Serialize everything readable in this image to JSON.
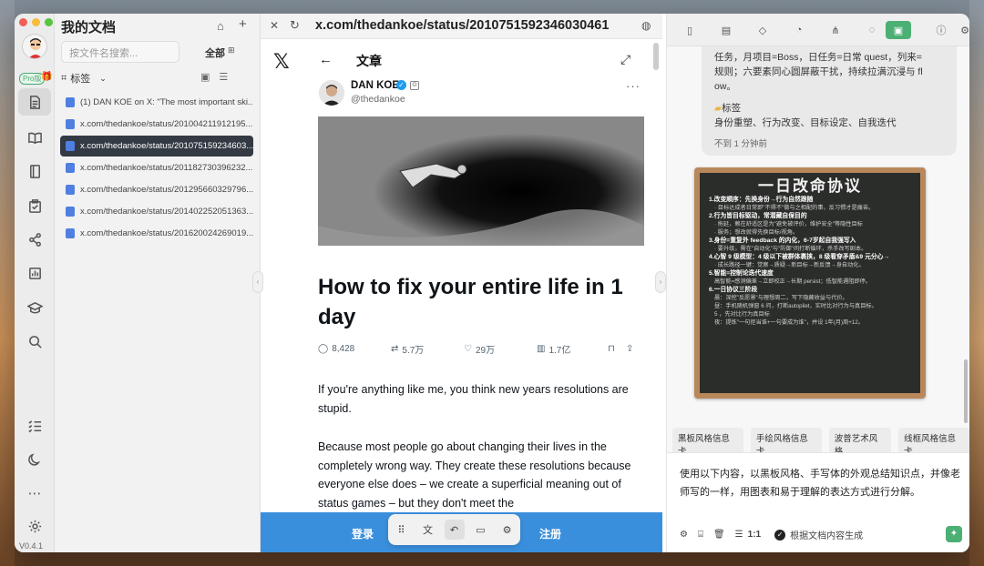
{
  "sidebar": {
    "pro_label": "Pro版",
    "version": "V0.4.1"
  },
  "docs": {
    "title": "我的文档",
    "search_placeholder": "按文件名搜索...",
    "filter_label": "全部",
    "tag_label": "标签",
    "items": [
      {
        "label": "(1) DAN KOE on X: \"The most important ski..."
      },
      {
        "label": "x.com/thedankoe/status/201004211912195..."
      },
      {
        "label": "x.com/thedankoe/status/201075159234603..."
      },
      {
        "label": "x.com/thedankoe/status/201182730396232..."
      },
      {
        "label": "x.com/thedankoe/status/201295660329796..."
      },
      {
        "label": "x.com/thedankoe/status/201402252051363..."
      },
      {
        "label": "x.com/thedankoe/status/201620024269019..."
      }
    ]
  },
  "browser": {
    "url": "x.com/thedankoe/status/2010751592346030461",
    "header_label": "文章",
    "author_name": "DAN KOE",
    "author_handle": "@thedankoe",
    "headline": "How to fix your entire life in 1 day",
    "stats": {
      "replies": "8,428",
      "reposts": "5.7万",
      "likes": "29万",
      "views": "1.7亿"
    },
    "para1": "If you're anything like me, you think new years resolutions are stupid.",
    "para2": "Because most people go about changing their lives in the completely wrong way. They create these resolutions because everyone else does – we create a superficial meaning out of status games – but they don't meet the",
    "login": "登录",
    "signup": "注册"
  },
  "ai": {
    "bubble_line1": "任务，月项目=Boss，日任务=日常 quest，列来=",
    "bubble_line2": "规则；六要素同心圆屏蔽干扰，持续拉满沉浸与 fl",
    "bubble_line3": "ow。",
    "tag_title": "标签",
    "tags": "身份重塑、行为改变、目标设定、自我迭代",
    "time": "不到 1 分钟前",
    "board": {
      "title": "一日改命协议",
      "lines": [
        {
          "t": "1.改变顺序：先换身份→行为自然跟随",
          "h": true
        },
        {
          "t": "· 目标达成者日常即\"不得不\"做与之相配的事，反习惯才是痛苦。",
          "h": false
        },
        {
          "t": "2.行为皆目标驱动，常潜藏自保目的",
          "h": true
        },
        {
          "t": "· 拖延，赖在舒适区是为\"避免被评价，维护安全\"等隐性目标",
          "h": false
        },
        {
          "t": "· 服务；想改就得先换目标/视角。",
          "h": false
        },
        {
          "t": "3.身份=重复外 feedback 的内化，6-7岁起自我强写入",
          "h": true
        },
        {
          "t": "· 要升级，需在\"自动化\"与\"防御\"间打断循环，杀手改写剧本。",
          "h": false
        },
        {
          "t": "4.心智 9 级模型：4 级以下被群体裹挟，8 级看穿矛盾&9 元分心→",
          "h": true
        },
        {
          "t": "· 成长路径一键：觉察→质疑→新目标→新反馈→身自动化。",
          "h": false
        },
        {
          "t": "5.智能=控制论迭代速度",
          "h": true
        },
        {
          "t": "高智能=感测偏差→立即校正→长期 persist；低智能遇阻即停。",
          "h": false
        },
        {
          "t": "6.一日协议三阶段",
          "h": true
        },
        {
          "t": "晨：深挖\"反愿景\"与理想周二，写下隐藏收益与代价。",
          "h": false
        },
        {
          "t": "昼：手机随机弹窗 6 问，打断autopilet，实时比对行为与真目标。",
          "h": false
        },
        {
          "t": "5 ，先对比行为真目标",
          "h": false
        },
        {
          "t": "夜：提炼\"一句拒当谁+一句要成为谁\"，并设 1年(月)周+12。",
          "h": false
        }
      ]
    },
    "chips": [
      "黑板风格信息卡",
      "手绘风格信息卡",
      "波普艺术风格",
      "线框风格信息卡"
    ],
    "composer_text": "使用以下内容，以黑板风格、手写体的外观总结知识点，并像老师写的一样，用图表和易于理解的表达方式进行分解。",
    "ratio": "1:1",
    "generate_label": "根据文档内容生成"
  }
}
